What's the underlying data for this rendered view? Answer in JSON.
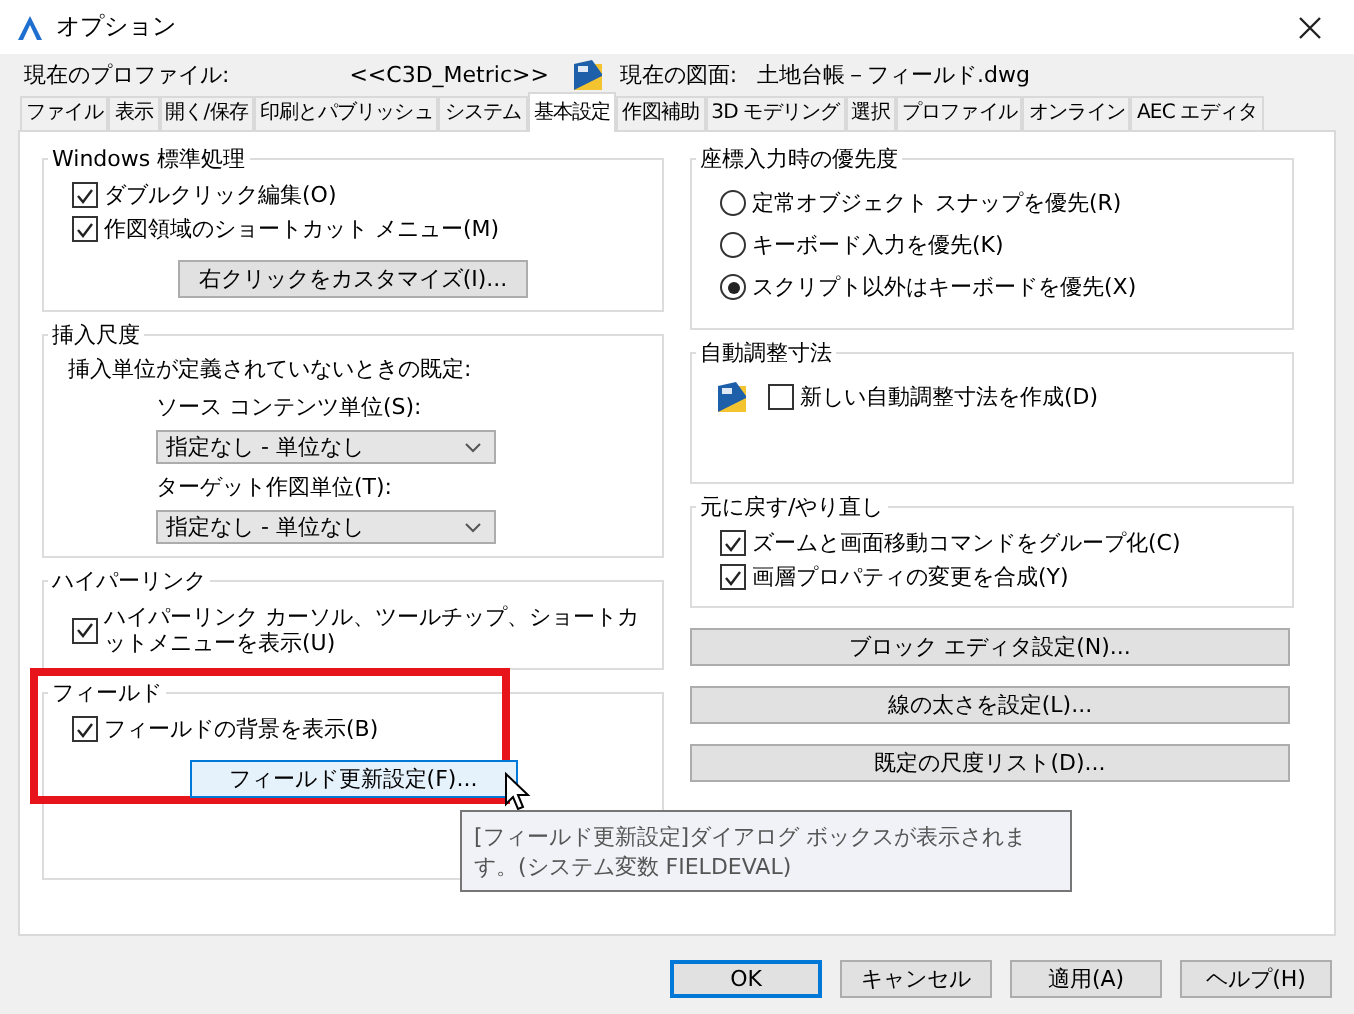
{
  "window": {
    "title": "オプション"
  },
  "profile": {
    "label": "現在のプロファイル:",
    "value": "<<C3D_Metric>>",
    "drawing_label": "現在の図面:",
    "drawing_value": "土地台帳－フィールド.dwg"
  },
  "tabs": [
    {
      "label": "ファイル",
      "selected": false
    },
    {
      "label": "表示",
      "selected": false
    },
    {
      "label": "開く/保存",
      "selected": false
    },
    {
      "label": "印刷とパブリッシュ",
      "selected": false
    },
    {
      "label": "システム",
      "selected": false
    },
    {
      "label": "基本設定",
      "selected": true
    },
    {
      "label": "作図補助",
      "selected": false
    },
    {
      "label": "3D モデリング",
      "selected": false
    },
    {
      "label": "選択",
      "selected": false
    },
    {
      "label": "プロファイル",
      "selected": false
    },
    {
      "label": "オンライン",
      "selected": false
    },
    {
      "label": "AEC エディタ",
      "selected": false
    }
  ],
  "columns": [
    {
      "entries": [
        {
          "kind": "group",
          "title": "Windows 標準処理",
          "highlighted": false,
          "items": [
            {
              "kind": "checkbox",
              "label": "ダブルクリック編集(O)",
              "checked": true
            },
            {
              "kind": "checkbox",
              "label": "作図領域のショートカット メニュー(M)",
              "checked": true
            },
            {
              "kind": "button",
              "label": "右クリックをカスタマイズ(I)...",
              "hovered": false
            }
          ]
        },
        {
          "kind": "group",
          "title": "挿入尺度",
          "highlighted": false,
          "items": [
            {
              "kind": "text",
              "label": "挿入単位が定義されていないときの既定:"
            },
            {
              "kind": "sublabel",
              "label": "ソース コンテンツ単位(S):"
            },
            {
              "kind": "dropdown",
              "value": "指定なし - 単位なし"
            },
            {
              "kind": "sublabel",
              "label": "ターゲット作図単位(T):"
            },
            {
              "kind": "dropdown",
              "value": "指定なし - 単位なし"
            }
          ]
        },
        {
          "kind": "group",
          "title": "ハイパーリンク",
          "highlighted": false,
          "items": [
            {
              "kind": "checkbox",
              "label": "ハイパーリンク カーソル、ツールチップ、ショートカットメニューを表示(U)",
              "checked": true
            }
          ]
        },
        {
          "kind": "group",
          "title": "フィールド",
          "highlighted": true,
          "items": [
            {
              "kind": "checkbox",
              "label": "フィールドの背景を表示(B)",
              "checked": true
            },
            {
              "kind": "button",
              "label": "フィールド更新設定(F)...",
              "hovered": true
            }
          ]
        }
      ]
    },
    {
      "entries": [
        {
          "kind": "group",
          "title": "座標入力時の優先度",
          "highlighted": false,
          "items": [
            {
              "kind": "radio",
              "label": "定常オブジェクト スナップを優先(R)",
              "selected": false
            },
            {
              "kind": "radio",
              "label": "キーボード入力を優先(K)",
              "selected": false
            },
            {
              "kind": "radio",
              "label": "スクリプト以外はキーボードを優先(X)",
              "selected": true
            }
          ]
        },
        {
          "kind": "group",
          "title": "自動調整寸法",
          "highlighted": false,
          "items": [
            {
              "kind": "iconcheckbox",
              "label": "新しい自動調整寸法を作成(D)",
              "checked": false
            }
          ]
        },
        {
          "kind": "group",
          "title": "元に戻す/やり直し",
          "highlighted": false,
          "items": [
            {
              "kind": "checkbox",
              "label": "ズームと画面移動コマンドをグループ化(C)",
              "checked": true
            },
            {
              "kind": "checkbox",
              "label": "画層プロパティの変更を合成(Y)",
              "checked": true
            }
          ]
        },
        {
          "kind": "button",
          "label": "ブロック エディタ設定(N)...",
          "hovered": false
        },
        {
          "kind": "button",
          "label": "線の太さを設定(L)...",
          "hovered": false
        },
        {
          "kind": "button",
          "label": "既定の尺度リスト(D)...",
          "hovered": false
        }
      ]
    }
  ],
  "tooltip": {
    "text": "[フィールド更新設定]ダイアログ ボックスが表示されます。(システム変数 FIELDEVAL)"
  },
  "buttons": [
    {
      "label": "OK",
      "default": true
    },
    {
      "label": "キャンセル",
      "default": false
    },
    {
      "label": "適用(A)",
      "default": false
    },
    {
      "label": "ヘルプ(H)",
      "default": false
    }
  ]
}
